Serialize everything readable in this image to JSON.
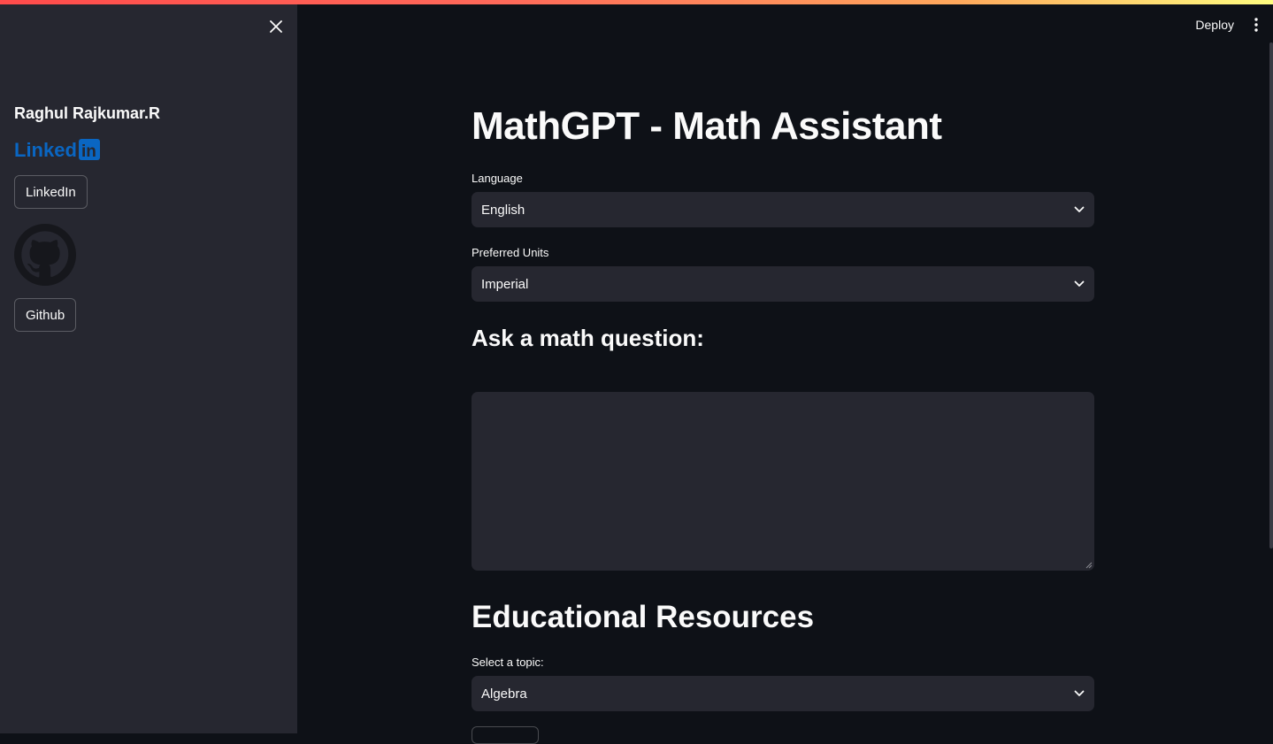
{
  "sidebar": {
    "profile_name": "Raghul Rajkumar.R",
    "linkedin_logo_text": "Linked",
    "linkedin_logo_in": "in",
    "linkedin_button": "LinkedIn",
    "github_button": "Github"
  },
  "header": {
    "deploy_label": "Deploy"
  },
  "main": {
    "title": "MathGPT - Math Assistant",
    "language": {
      "label": "Language",
      "value": "English"
    },
    "units": {
      "label": "Preferred Units",
      "value": "Imperial"
    },
    "question_heading": "Ask a math question:",
    "question_value": "",
    "resources_heading": "Educational Resources",
    "topic": {
      "label": "Select a topic:",
      "value": "Algebra"
    }
  },
  "colors": {
    "background": "#0e1117",
    "sidebar": "#262730",
    "input": "#262730",
    "linkedin_blue": "#0a66c2",
    "accent_gradient_start": "#ff4b4b",
    "accent_gradient_end": "#fffd80"
  },
  "icons": [
    "close-icon",
    "linkedin-logo",
    "github-logo",
    "kebab-menu-icon",
    "chevron-down-icon"
  ]
}
